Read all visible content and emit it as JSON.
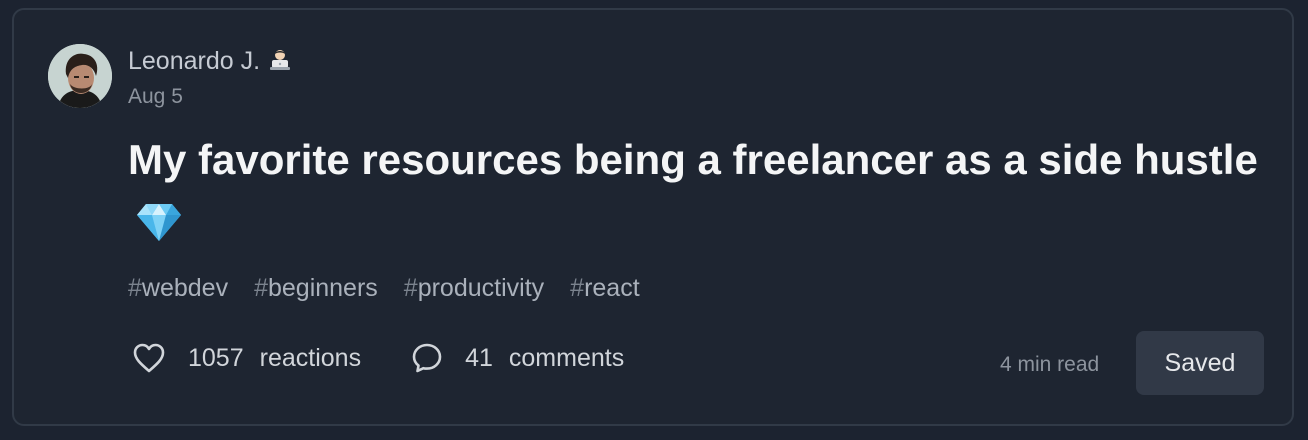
{
  "post": {
    "author": "Leonardo J.",
    "author_emoji_icon": "technologist-emoji-icon",
    "date": "Aug 5",
    "title": "My favorite resources being a freelancer as a side hustle",
    "title_emoji_icon": "gem-emoji-icon",
    "tags": [
      {
        "hash": "#",
        "name": "webdev"
      },
      {
        "hash": "#",
        "name": "beginners"
      },
      {
        "hash": "#",
        "name": "productivity"
      },
      {
        "hash": "#",
        "name": "react"
      }
    ],
    "reactions": {
      "count": "1057",
      "label": "reactions",
      "icon": "heart-icon"
    },
    "comments": {
      "count": "41",
      "label": "comments",
      "icon": "comment-icon"
    },
    "read_time": "4 min read",
    "saved_label": "Saved"
  },
  "colors": {
    "background": "#1e2531",
    "card_border": "#313a47",
    "title_text": "#f4f5f6",
    "muted_text": "#8d949e",
    "button_bg": "#313947"
  }
}
